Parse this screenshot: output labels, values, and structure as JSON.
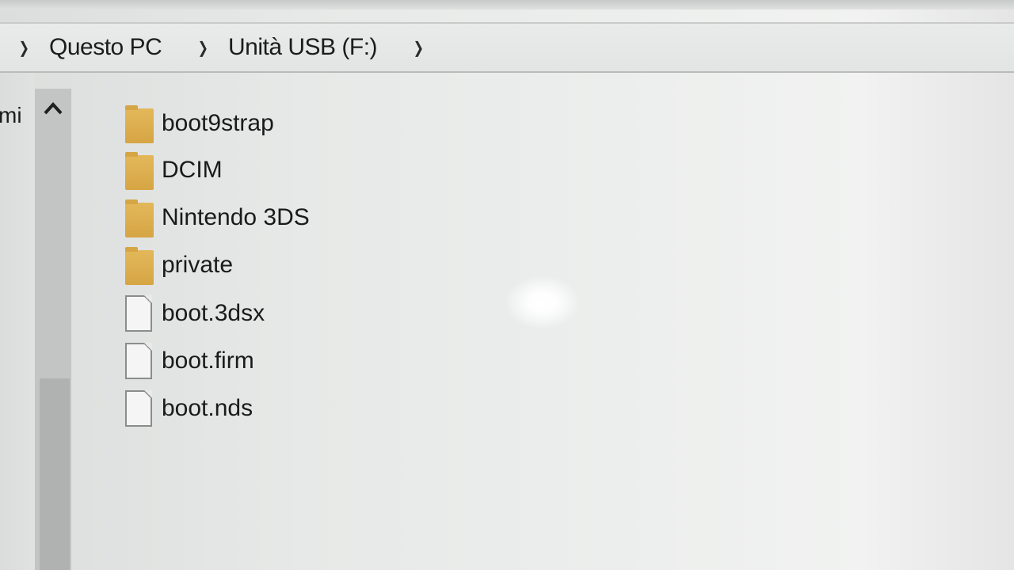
{
  "breadcrumb": {
    "items": [
      "Questo PC",
      "Unità USB (F:)"
    ]
  },
  "nav_pane": {
    "partial_label": "mi"
  },
  "scrollbar": {
    "up_icon": "chevron-up-icon"
  },
  "files": [
    {
      "name": "boot9strap",
      "type": "folder"
    },
    {
      "name": "DCIM",
      "type": "folder"
    },
    {
      "name": "Nintendo 3DS",
      "type": "folder"
    },
    {
      "name": "private",
      "type": "folder"
    },
    {
      "name": "boot.3dsx",
      "type": "file"
    },
    {
      "name": "boot.firm",
      "type": "file"
    },
    {
      "name": "boot.nds",
      "type": "file"
    }
  ],
  "colors": {
    "folder": "#dcab4a",
    "background": "#e9ebea",
    "text": "#1a1a1a"
  }
}
